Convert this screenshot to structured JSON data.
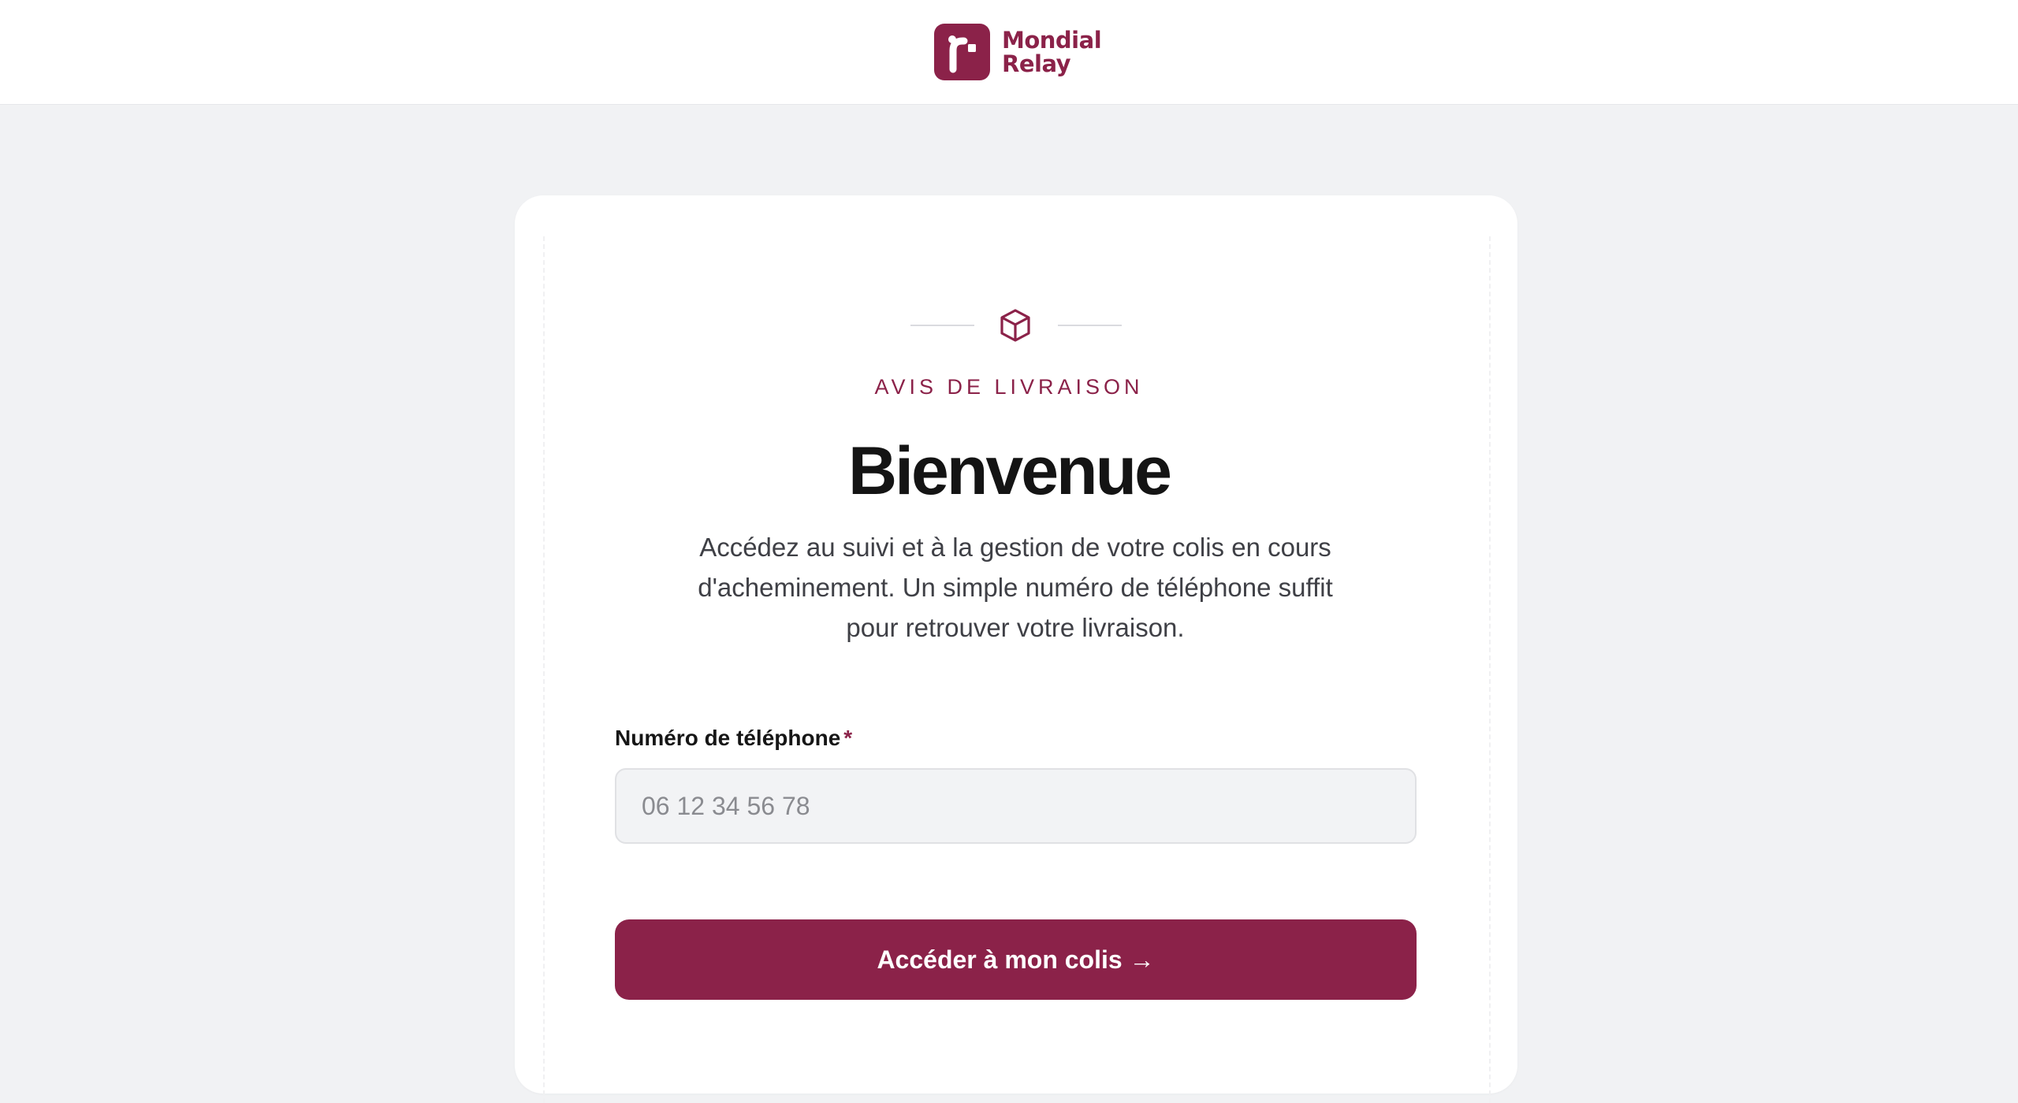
{
  "brand": {
    "name_line1": "Mondial",
    "name_line2": "Relay",
    "color": "#8b2249"
  },
  "hero": {
    "icon": "package-box-icon",
    "eyebrow": "AVIS DE LIVRAISON",
    "title": "Bienvenue",
    "description": "Accédez au suivi et à la gestion de votre colis en cours d'acheminement. Un simple numéro de téléphone suffit pour retrouver votre livraison."
  },
  "form": {
    "phone_label": "Numéro de téléphone",
    "required_mark": "*",
    "phone_placeholder": "06 12 34 56 78",
    "phone_value": "",
    "submit_label": "Accéder à mon colis →"
  }
}
